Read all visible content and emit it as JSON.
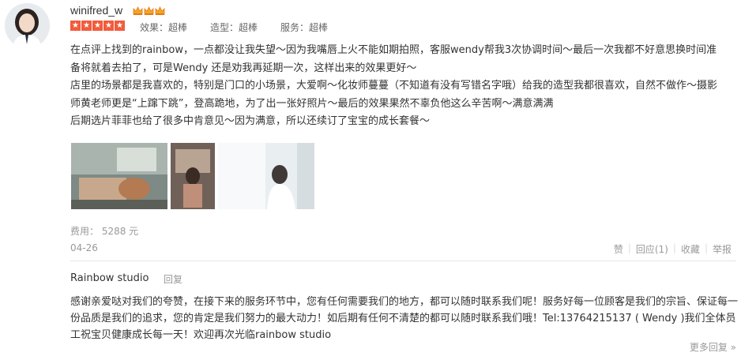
{
  "user": {
    "name": "winifred_w",
    "crown_count": 3,
    "rating_stars": 5
  },
  "scores": [
    {
      "label": "效果：超棒"
    },
    {
      "label": "造型：超棒"
    },
    {
      "label": "服务：超棒"
    }
  ],
  "review": {
    "paragraphs": [
      "在点评上找到的rainbow，一点都没让我失望～因为我嘴唇上火不能如期拍照，客服wendy帮我3次协调时间～最后一次我都不好意思换时间准备将就着去拍了，可是Wendy 还是劝我再延期一次，这样出来的效果更好～",
      "店里的场景都是我喜欢的，特别是门口的小场景，大爱啊～化妆师蔓蔓（不知道有没有写错名字哦）给我的造型我都很喜欢，自然不做作～摄影师黄老师更是“上蹿下跳”，登高跪地，为了出一张好照片～最后的效果果然不辜负他这么辛苦啊～满意满满",
      "后期选片菲菲也给了很多中肯意见～因为满意，所以还续订了宝宝的成长套餐～"
    ]
  },
  "cost": "费用： 5288 元",
  "date": "04-26",
  "actions": {
    "like": "赞",
    "reply": "回应(1)",
    "favorite": "收藏",
    "report": "举报"
  },
  "merchant_reply": {
    "name": "Rainbow studio",
    "tag": "回复",
    "text": "感谢亲爱哒对我们的夸赞，在接下来的服务环节中，您有任何需要我们的地方，都可以随时联系我们呢！服务好每一位顾客是我们的宗旨、保证每一份品质是我们的追求，您的肯定是我们努力的最大动力！如后期有任何不清楚的都可以随时联系我们哦！Tel:13764215137 ( Wendy )我们全体员工祝宝贝健康成长每一天！欢迎再次光临rainbow studio",
    "more": "更多回复 »"
  },
  "colors": {
    "star": "#f25b3c",
    "crown": "#f5a623",
    "muted": "#999999",
    "text": "#333333"
  }
}
